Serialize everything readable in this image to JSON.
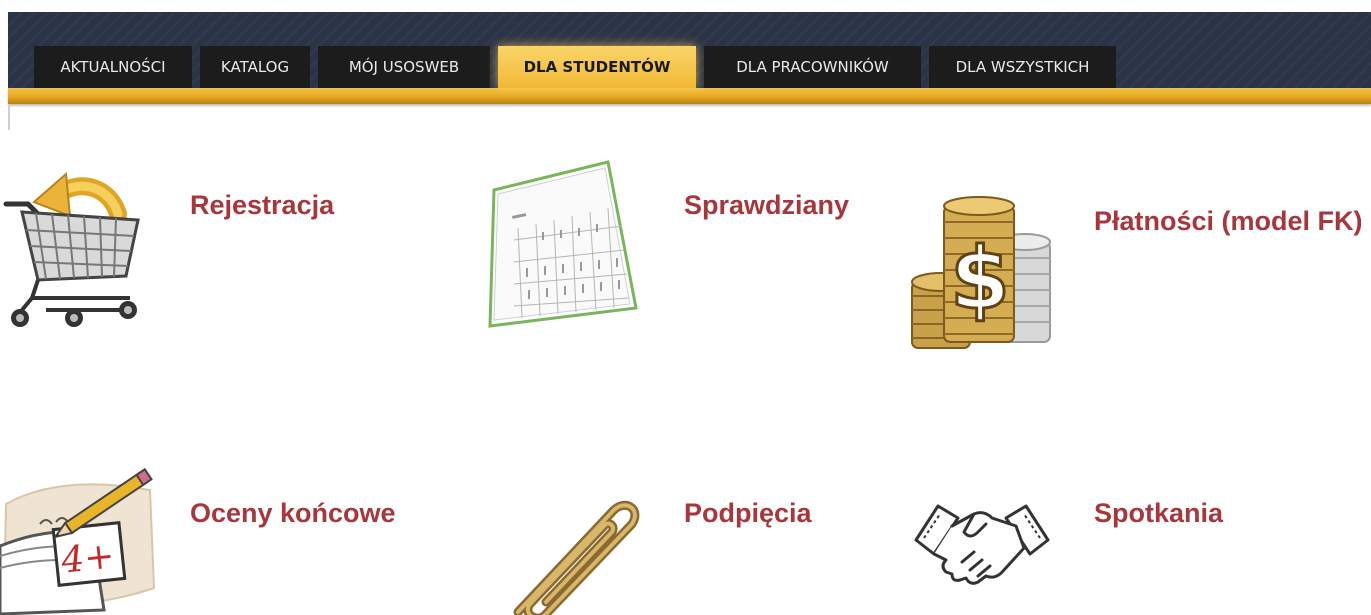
{
  "nav": {
    "tabs": [
      {
        "label": "AKTUALNOŚCI",
        "active": false
      },
      {
        "label": "KATALOG",
        "active": false
      },
      {
        "label": "MÓJ USOSWEB",
        "active": false
      },
      {
        "label": "DLA STUDENTÓW",
        "active": true
      },
      {
        "label": "DLA PRACOWNIKÓW",
        "active": false
      },
      {
        "label": "DLA WSZYSTKICH",
        "active": false
      }
    ]
  },
  "tiles": [
    {
      "title": "Rejestracja",
      "icon": "shopping-cart-icon"
    },
    {
      "title": "Sprawdziany",
      "icon": "test-sheet-icon"
    },
    {
      "title": "Płatności (model FK)",
      "icon": "coins-dollar-icon"
    },
    {
      "title": "Oceny końcowe",
      "icon": "gradebook-icon"
    },
    {
      "title": "Podpięcia",
      "icon": "paperclip-icon"
    },
    {
      "title": "Spotkania",
      "icon": "handshake-icon"
    }
  ],
  "colors": {
    "nav_bg": "#2b3347",
    "tab_bg": "#1c1c1c",
    "tab_active": "#f0b934",
    "accent_line": "#e7a820",
    "tile_title": "#a8373d"
  }
}
